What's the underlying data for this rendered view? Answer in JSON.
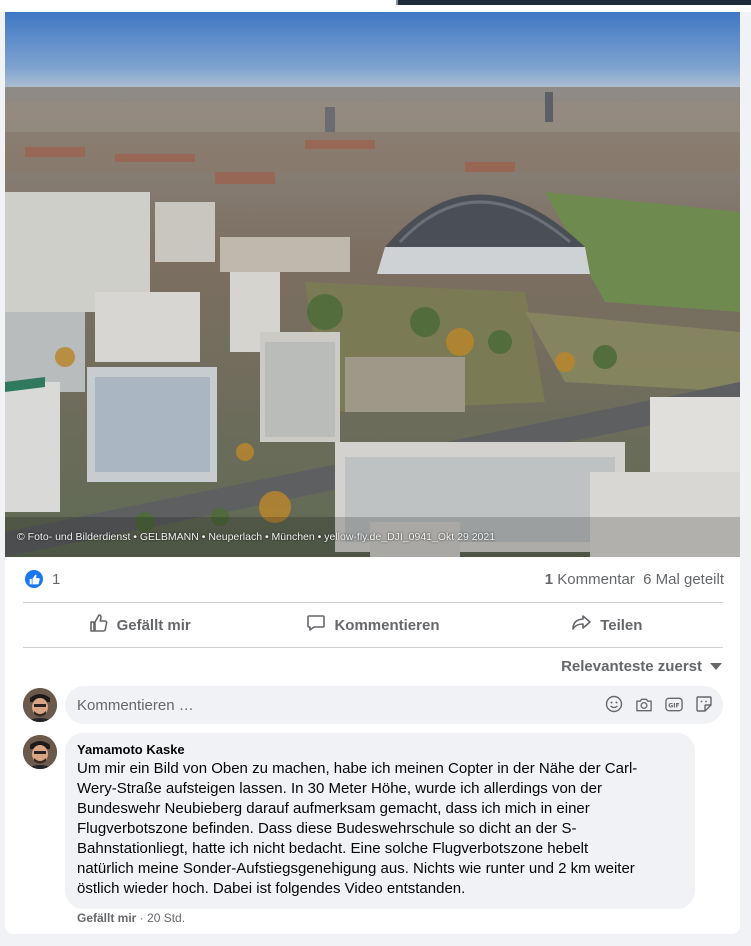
{
  "photo": {
    "watermark": "© Foto- und Bilderdienst • GELBMANN • Neuperlach • München • yellow-fly.de_DJI_0941_Okt 29 2021"
  },
  "reactions": {
    "like_count": "1",
    "comments_count": "1",
    "comments_label": "Kommentar",
    "shares_text": "6 Mal geteilt",
    "like_color": "#1877f2"
  },
  "actions": {
    "like_label": "Gefällt mir",
    "comment_label": "Kommentieren",
    "share_label": "Teilen"
  },
  "sort": {
    "label": "Relevanteste zuerst"
  },
  "composer": {
    "placeholder": "Kommentieren …",
    "icons": [
      "emoji-icon",
      "camera-icon",
      "gif-icon",
      "sticker-icon"
    ]
  },
  "comment": {
    "author": "Yamamoto Kaske",
    "lines": [
      "Um mir ein Bild von Oben zu machen, habe ich meinen Copter in der Nähe der Carl-",
      "Wery-Straße aufsteigen lassen. In 30 Meter Höhe, wurde ich allerdings von der",
      "Bundeswehr Neubieberg darauf aufmerksam gemacht, dass ich mich in einer",
      "Flugverbotszone befinden. Dass diese Budeswehrschule so dicht an der S-",
      "Bahnstationliegt, hatte ich nicht bedacht. Eine solche Flugverbotszone hebelt",
      "natürlich meine Sonder-Aufstiegsgenehigung aus. Nichts wie runter und 2 km weiter",
      "östlich wieder hoch. Dabei ist folgendes Video entstanden."
    ],
    "like_label": "Gefällt mir",
    "separator": " · ",
    "time": "20 Std."
  }
}
